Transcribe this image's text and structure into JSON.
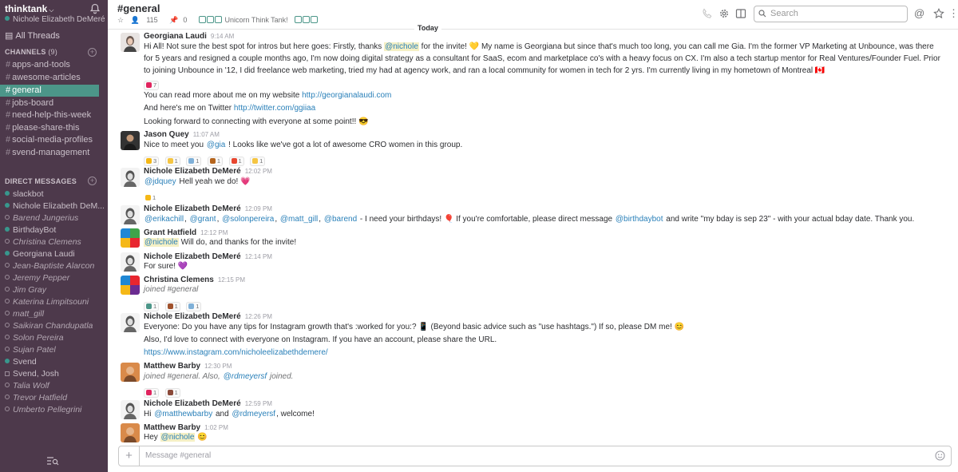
{
  "sidebar": {
    "team": "thinktank",
    "user": "Nichole Elizabeth DeMeré",
    "all_threads": "All Threads",
    "channels_heading": "CHANNELS",
    "channels_count": "(9)",
    "channels": [
      {
        "name": "apps-and-tools"
      },
      {
        "name": "awesome-articles"
      },
      {
        "name": "general"
      },
      {
        "name": "jobs-board"
      },
      {
        "name": "need-help-this-week"
      },
      {
        "name": "please-share-this"
      },
      {
        "name": "social-media-profiles"
      },
      {
        "name": "svend-management"
      }
    ],
    "dm_heading": "DIRECT MESSAGES",
    "dms": [
      {
        "name": "slackbot"
      },
      {
        "name": "Nichole Elizabeth DeM..."
      },
      {
        "name": "Barend Jungerius"
      },
      {
        "name": "BirthdayBot"
      },
      {
        "name": "Christina Clemens"
      },
      {
        "name": "Georgiana Laudi"
      },
      {
        "name": "Jean-Baptiste Alarcon"
      },
      {
        "name": "Jeremy Pepper"
      },
      {
        "name": "Jim Gray"
      },
      {
        "name": "Katerina Limpitsouni"
      },
      {
        "name": "matt_gill"
      },
      {
        "name": "Saikiran Chandupatla"
      },
      {
        "name": "Solon Pereira"
      },
      {
        "name": "Sujan Patel"
      },
      {
        "name": "Svend"
      },
      {
        "name": "Svend, Josh"
      },
      {
        "name": "Talia Wolf"
      },
      {
        "name": "Trevor Hatfield"
      },
      {
        "name": "Umberto Pellegrini"
      }
    ]
  },
  "header": {
    "channel": "#general",
    "members": "115",
    "pins": "0",
    "topic": "Unicorn Think Tank!",
    "search_placeholder": "Search",
    "date_divider": "Today"
  },
  "messages": [
    {
      "author": "Georgiana Laudi",
      "time": "9:14 AM",
      "l1a": "Hi All! Not sure the best spot for intros but here goes: Firstly, thanks ",
      "m1": "@nichole",
      "l1b": " for the invite! 💛 My name is Georgiana but since that's much too long, you can call me Gia. I'm the former VP Marketing at Unbounce, was there for 5 years and resigned a couple months ago, I'm now doing digital strategy as a consultant for SaaS, ecom and marketplace co's with a heavy focus on CX. I'm also a tech startup mentor for Real Ventures/Founder Fuel. Prior to joining Unbounce in '12, I did freelance web marketing, tried my had at agency work, and ran a local community for women in tech for 2 yrs. I'm currently living in my hometown of Montreal 🇨🇦",
      "r1": "7",
      "p2": "You can read more about me on my website ",
      "link2": "http://georgianalaudi.com",
      "p3": "And here's me on Twitter ",
      "link3": "http://twitter.com/ggiiaa",
      "p4": "Looking forward to connecting with everyone at some point!! 😎"
    },
    {
      "author": "Jason Quey",
      "time": "11:07 AM",
      "a": "Nice to meet you ",
      "m": "@gia",
      "b": " ! Looks like we've got a lot of awesome CRO women in this group.",
      "reactions": [
        "3",
        "1",
        "1",
        "1",
        "1",
        "1"
      ]
    },
    {
      "author": "Nichole Elizabeth DeMeré",
      "time": "12:02 PM",
      "m": "@jdquey",
      "b": " Hell yeah we do! 💗",
      "reactions": [
        "1"
      ]
    },
    {
      "author": "Nichole Elizabeth DeMeré",
      "time": "12:09 PM",
      "m1": "@erikachill",
      "m2": "@grant",
      "m3": "@solonpereira",
      "m4": "@matt_gill",
      "m5": "@barend",
      "b": " - I need your birthdays! 🎈 If you're comfortable, please direct message ",
      "m6": "@birthdaybot",
      "c": " and write \"my bday is sep 23\" - with your actual bday date. Thank you."
    },
    {
      "author": "Grant Hatfield",
      "time": "12:12 PM",
      "m": "@nichole",
      "b": " Will do, and thanks for the invite!"
    },
    {
      "author": "Nichole Elizabeth DeMeré",
      "time": "12:14 PM",
      "text": "For sure! 💜"
    },
    {
      "author": "Christina Clemens",
      "time": "12:15 PM",
      "text": "joined #general",
      "reactions": [
        "1",
        "1",
        "1"
      ]
    },
    {
      "author": "Nichole Elizabeth DeMeré",
      "time": "12:26 PM",
      "p1": "Everyone: Do you have any tips for Instagram growth that's :worked for you:? 📱 (Beyond basic advice such as \"use hashtags.\") If so, please DM me! 😊",
      "p2": "Also, I'd love to connect with everyone on Instagram. If you have an account, please share the URL.",
      "link": "https://www.instagram.com/nicholeelizabethdemere/"
    },
    {
      "author": "Matthew Barby",
      "time": "12:30 PM",
      "a": "joined #general. Also, ",
      "m": "@rdmeyersf",
      "b": " joined.",
      "reactions": [
        "1",
        "1"
      ]
    },
    {
      "author": "Nichole Elizabeth DeMeré",
      "time": "12:59 PM",
      "a": "Hi ",
      "m1": "@matthewbarby",
      "mid": " and ",
      "m2": "@rdmeyersf",
      "b": ", welcome!"
    },
    {
      "author": "Matthew Barby",
      "time": "1:02 PM",
      "a": "Hey ",
      "m": "@nichole",
      "b": " 😊"
    }
  ],
  "composer": {
    "placeholder": "Message #general"
  },
  "colors": {
    "sidebar": "#4d394b",
    "active": "#4c9689",
    "link": "#2a80b9",
    "mention_bg": "#f5f0c5"
  }
}
